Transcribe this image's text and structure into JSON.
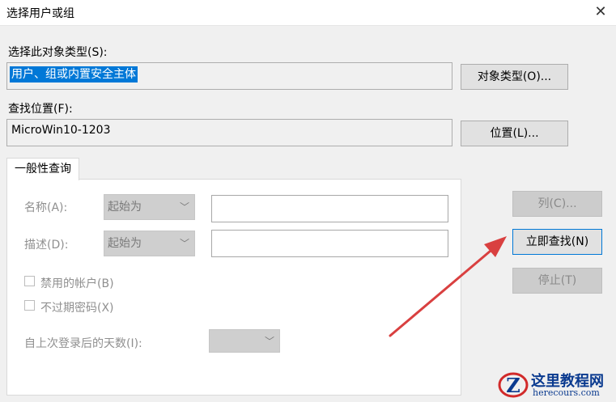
{
  "window": {
    "title": "选择用户或组",
    "close_label": "✕"
  },
  "object_type": {
    "label": "选择此对象类型(S):",
    "value": "用户、组或内置安全主体",
    "button": "对象类型(O)..."
  },
  "location": {
    "label": "查找位置(F):",
    "value": "MicroWin10-1203",
    "button": "位置(L)..."
  },
  "tab": {
    "label": "一般性查询"
  },
  "query": {
    "name_label": "名称(A):",
    "name_mode": "起始为",
    "desc_label": "描述(D):",
    "desc_mode": "起始为",
    "disabled_accounts": "禁用的帐户(B)",
    "non_expiring_pw": "不过期密码(X)",
    "days_since_login": "自上次登录后的天数(I):"
  },
  "buttons": {
    "columns": "列(C)...",
    "find_now": "立即查找(N)",
    "stop": "停止(T)"
  },
  "watermark": {
    "site_name": "这里教程网",
    "site_url": "herecours.com",
    "logo_letter": "Z"
  },
  "colors": {
    "selection": "#0078d7",
    "arrow": "#d94040",
    "watermark": "#0a3a8f"
  }
}
